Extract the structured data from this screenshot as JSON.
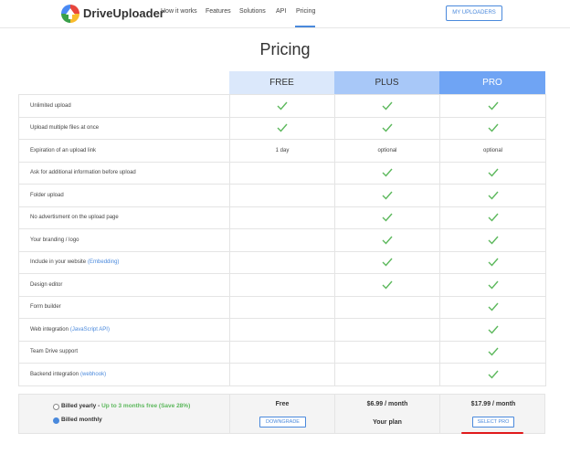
{
  "header": {
    "brand": "DriveUploader",
    "nav": [
      "How it works",
      "Features",
      "Solutions",
      "API",
      "Pricing"
    ],
    "active_nav": "Pricing",
    "my_uploaders": "MY UPLOADERS"
  },
  "title": "Pricing",
  "plans": [
    "FREE",
    "PLUS",
    "PRO"
  ],
  "features": [
    {
      "label": "Unlimited upload",
      "free": "check",
      "plus": "check",
      "pro": "check"
    },
    {
      "label": "Upload multiple files at once",
      "free": "check",
      "plus": "check",
      "pro": "check"
    },
    {
      "label": "Expiration of an upload link",
      "free": "1 day",
      "plus": "optional",
      "pro": "optional"
    },
    {
      "label": "Ask for additional information before upload",
      "free": "",
      "plus": "check",
      "pro": "check"
    },
    {
      "label": "Folder upload",
      "free": "",
      "plus": "check",
      "pro": "check"
    },
    {
      "label": "No advertisment on the upload page",
      "free": "",
      "plus": "check",
      "pro": "check"
    },
    {
      "label": "Your branding / logo",
      "free": "",
      "plus": "check",
      "pro": "check"
    },
    {
      "label": "Include in your website",
      "link": "(Embedding)",
      "free": "",
      "plus": "check",
      "pro": "check"
    },
    {
      "label": "Design editor",
      "free": "",
      "plus": "check",
      "pro": "check"
    },
    {
      "label": "Form builder",
      "free": "",
      "plus": "",
      "pro": "check"
    },
    {
      "label": "Web integration",
      "link": "(JavaScript API)",
      "free": "",
      "plus": "",
      "pro": "check"
    },
    {
      "label": "Team Drive support",
      "free": "",
      "plus": "",
      "pro": "check"
    },
    {
      "label": "Backend integration",
      "link": "(webhook)",
      "free": "",
      "plus": "",
      "pro": "check"
    }
  ],
  "billing": {
    "yearly_label": "Billed yearly - ",
    "yearly_promo": "Up to 3 months free (Save 28%)",
    "monthly_label": "Billed monthly",
    "selected": "monthly"
  },
  "footer": {
    "free_price": "Free",
    "free_button": "DOWNGRADE",
    "plus_price": "$6.99 / month",
    "plus_note": "Your plan",
    "pro_price": "$17.99 / month",
    "pro_button": "SELECT PRO"
  },
  "colors": {
    "accent": "#4a89dc",
    "check": "#5cb85c",
    "free_head": "#dbe8fb",
    "plus_head": "#a8c8f8",
    "pro_head": "#6fa4f4",
    "annotation": "#e0191b"
  }
}
